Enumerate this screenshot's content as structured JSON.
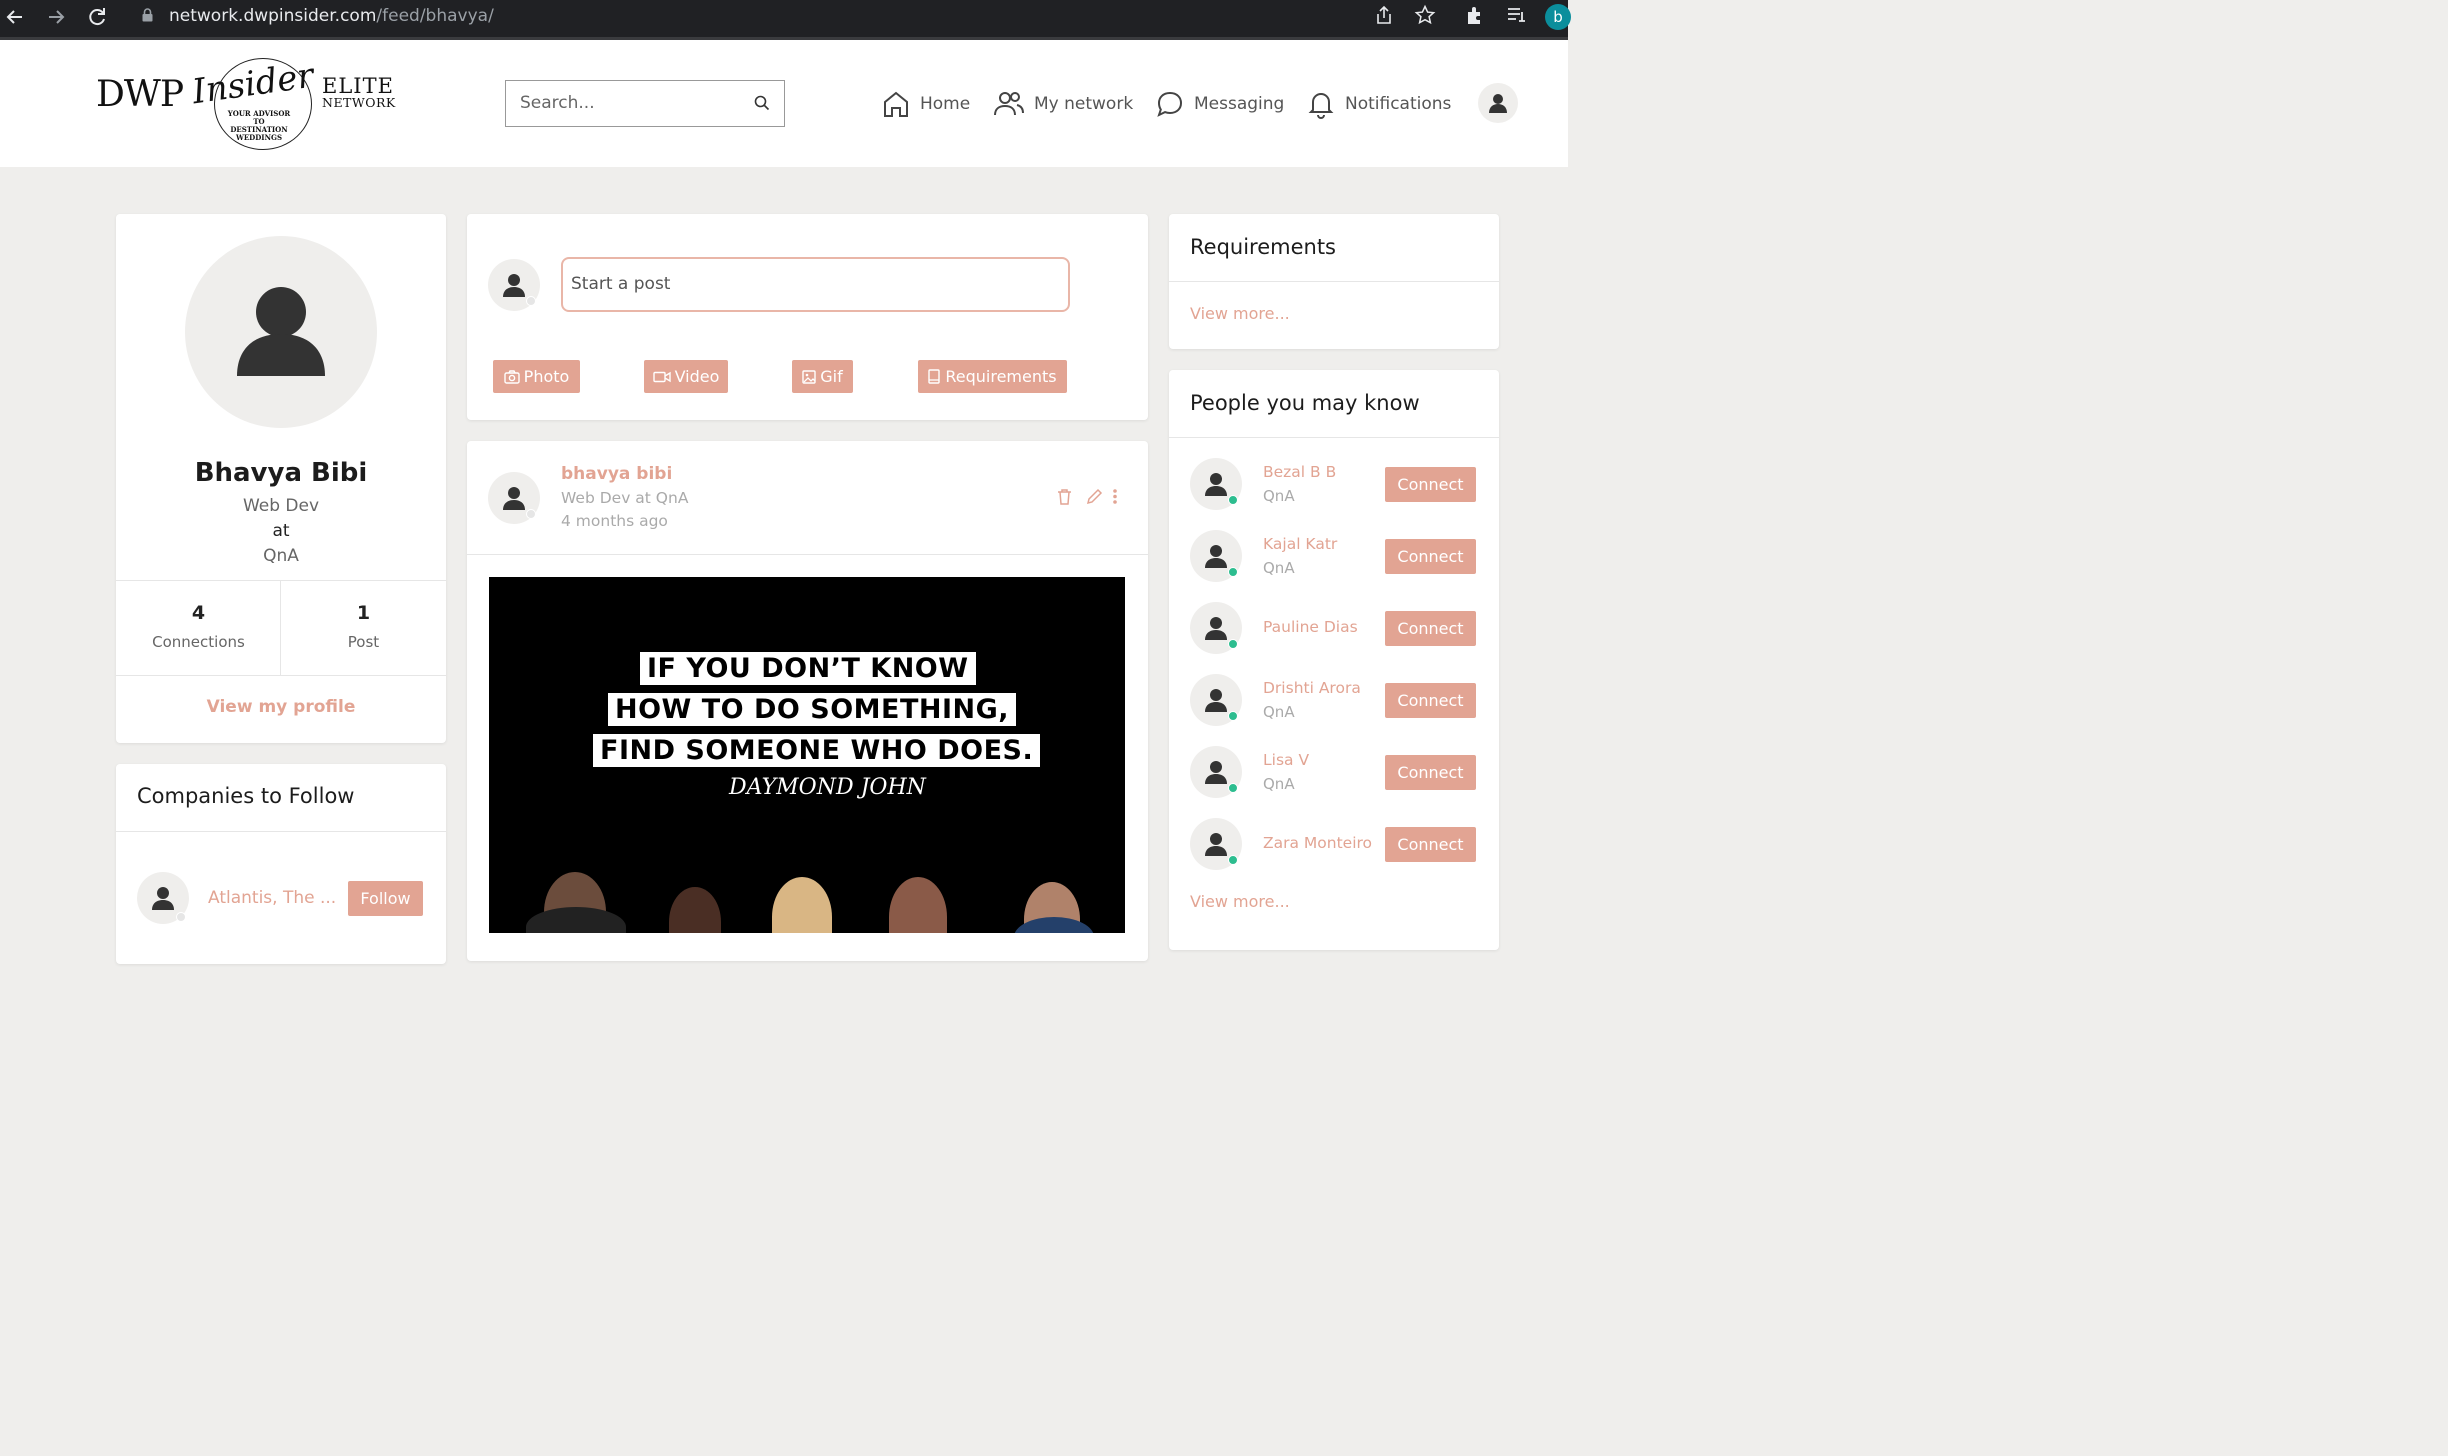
{
  "browser": {
    "url_host": "network.dwpinsider.com",
    "url_path": "/feed/bhavya/",
    "profile_initial": "b"
  },
  "logo": {
    "dwp": "DWP",
    "insider": "Insider",
    "tagline": "YOUR ADVISOR TO DESTINATION WEDDINGS",
    "elite": "ELITE",
    "network": "NETWORK"
  },
  "search": {
    "placeholder": "Search..."
  },
  "topnav": {
    "home": "Home",
    "network": "My network",
    "messaging": "Messaging",
    "notifications": "Notifications"
  },
  "profile": {
    "name": "Bhavya Bibi",
    "title": "Web Dev",
    "at": "at",
    "company": "QnA",
    "connections_count": "4",
    "connections_label": "Connections",
    "posts_count": "1",
    "posts_label": "Post",
    "view_profile": "View my profile"
  },
  "companies": {
    "title": "Companies to Follow",
    "items": [
      {
        "name": "Atlantis, The ...",
        "action": "Follow"
      }
    ]
  },
  "composer": {
    "placeholder": "Start a post",
    "buttons": {
      "photo": "Photo",
      "video": "Video",
      "gif": "Gif",
      "requirements": "Requirements"
    }
  },
  "post": {
    "author": "bhavya bibi",
    "subtitle": "Web Dev at QnA",
    "time": "4 months ago",
    "image_quote": [
      "IF YOU DON’T KNOW",
      "HOW TO DO SOMETHING,",
      "FIND SOMEONE WHO DOES."
    ],
    "image_signature": "DAYMOND JOHN"
  },
  "requirements": {
    "title": "Requirements",
    "view_more": "View more..."
  },
  "people": {
    "title": "People you may know",
    "connect_label": "Connect",
    "view_more": "View more...",
    "items": [
      {
        "name": "Bezal B B",
        "company": "QnA"
      },
      {
        "name": "Kajal Katr",
        "company": "QnA"
      },
      {
        "name": "Pauline Dias",
        "company": ""
      },
      {
        "name": "Drishti Arora",
        "company": "QnA"
      },
      {
        "name": "Lisa V",
        "company": "QnA"
      },
      {
        "name": "Zara Monteiro",
        "company": ""
      }
    ]
  },
  "colors": {
    "accent": "#e2a493",
    "online": "#2dbd8f",
    "background": "#efeeec"
  }
}
